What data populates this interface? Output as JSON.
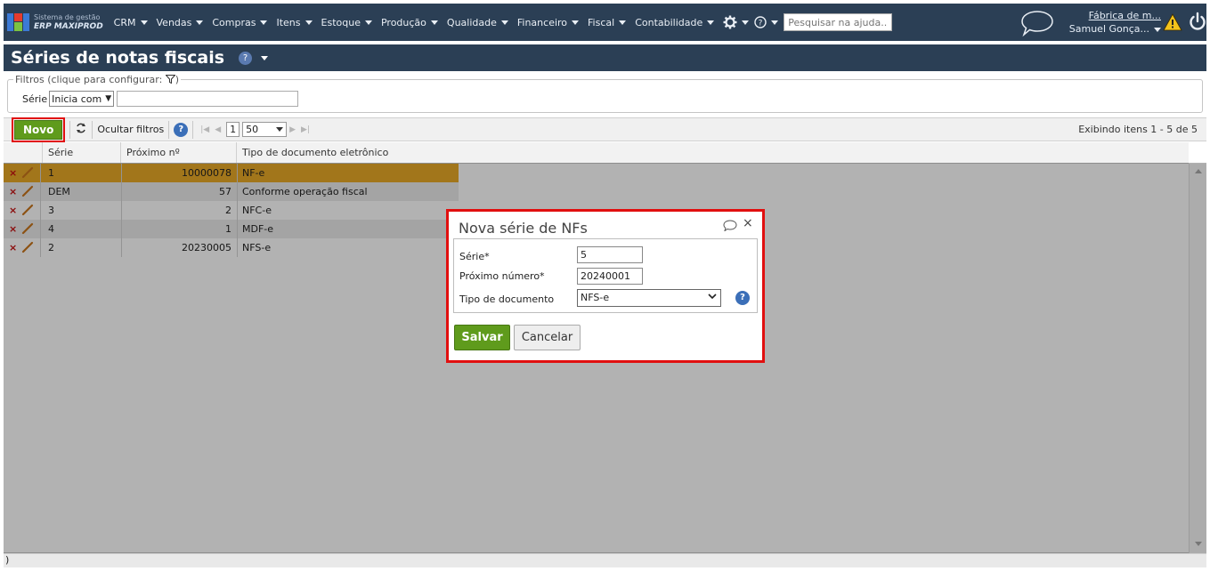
{
  "app": {
    "logo_line1": "Sistema de gestão",
    "logo_line2": "ERP MAXIPROD",
    "menu": [
      "CRM",
      "Vendas",
      "Compras",
      "Itens",
      "Estoque",
      "Produção",
      "Qualidade",
      "Financeiro",
      "Fiscal",
      "Contabilidade"
    ],
    "help_search_placeholder": "Pesquisar na ajuda...",
    "company": "Fábrica de m...",
    "user": "Samuel Gonça...",
    "brand_colors": {
      "nav_bg": "#2b3f55",
      "accent_green": "#5f9b1c",
      "highlight_row": "#e9a928",
      "callout_red": "#e10f0f"
    }
  },
  "page": {
    "title": "Séries de notas fiscais",
    "help_glyph": "?"
  },
  "filters": {
    "legend": "Filtros (clique para configurar:",
    "legend_end": ")",
    "serie_label": "Série",
    "operator": "Inicia com",
    "value": ""
  },
  "toolbar": {
    "new_label": "Novo",
    "hide_filters_label": "Ocultar filtros",
    "current_page": "1",
    "page_size": "50",
    "showing": "Exibindo itens 1 - 5 de 5"
  },
  "grid": {
    "columns": [
      "Série",
      "Próximo nº",
      "Tipo de documento eletrônico"
    ],
    "rows": [
      {
        "serie": "1",
        "proximo": "10000078",
        "tipo": "NF-e"
      },
      {
        "serie": "DEM",
        "proximo": "57",
        "tipo": "Conforme operação fiscal"
      },
      {
        "serie": "3",
        "proximo": "2",
        "tipo": "NFC-e"
      },
      {
        "serie": "4",
        "proximo": "1",
        "tipo": "MDF-e"
      },
      {
        "serie": "2",
        "proximo": "20230005",
        "tipo": "NFS-e"
      }
    ],
    "footer_text": ")"
  },
  "dialog": {
    "title": "Nova série de NFs",
    "serie_label": "Série*",
    "serie_value": "5",
    "proximo_label": "Próximo número*",
    "proximo_value": "20240001",
    "tipo_label": "Tipo de documento",
    "tipo_value": "NFS-e",
    "save_label": "Salvar",
    "cancel_label": "Cancelar"
  },
  "icons": {
    "delete": "close-icon",
    "edit": "pencil-icon",
    "settings": "gear-icon",
    "help": "help-icon",
    "chat": "chat-bubble-icon",
    "warning": "warning-icon",
    "power": "power-icon",
    "filter": "funnel-icon",
    "refresh": "refresh-icon"
  }
}
